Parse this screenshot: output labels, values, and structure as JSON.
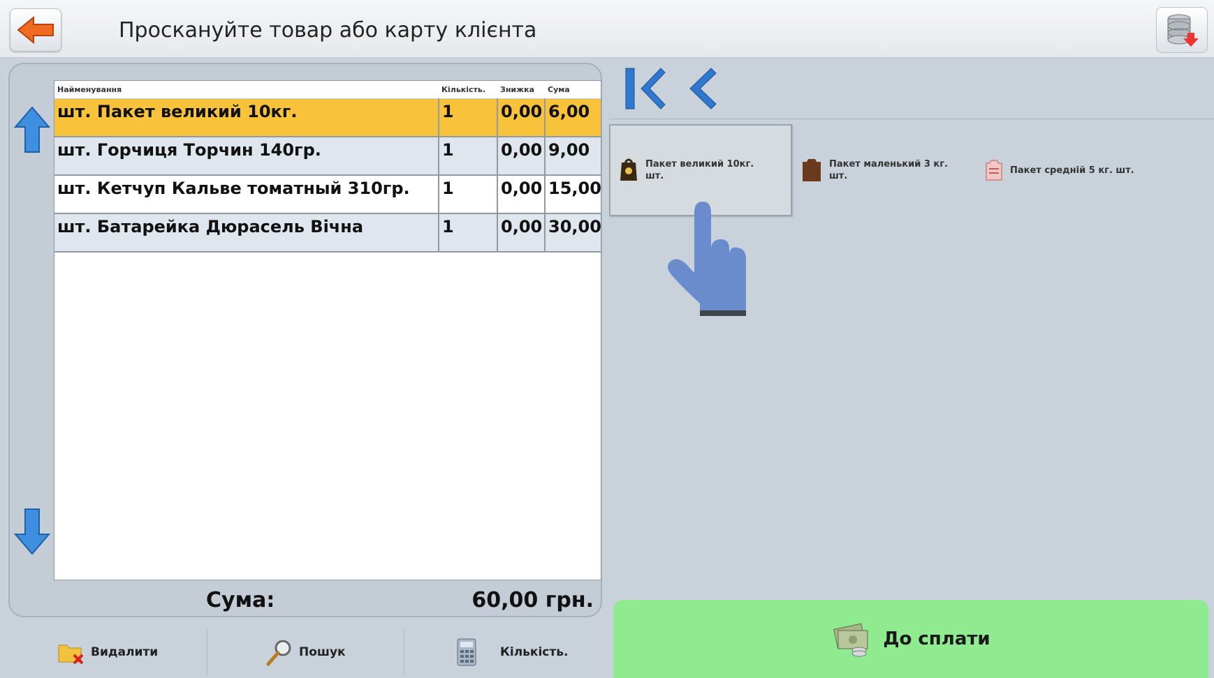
{
  "header": {
    "title": "Проскануйте товар або карту клієнта"
  },
  "table": {
    "columns": [
      "Найменування",
      "Кількість.",
      "Знижка",
      "Сума"
    ],
    "rows": [
      {
        "name": "шт. Пакет великий 10кг.",
        "qty": "1",
        "discount": "0,00",
        "sum": "6,00",
        "selected": true
      },
      {
        "name": "шт. Горчиця  Торчин 140гр.",
        "qty": "1",
        "discount": "0,00",
        "sum": "9,00"
      },
      {
        "name": "шт. Кетчуп Кальве томатный 310гр.",
        "qty": "1",
        "discount": "0,00",
        "sum": "15,00"
      },
      {
        "name": "шт. Батарейка Дюрасель Вічна",
        "qty": "1",
        "discount": "0,00",
        "sum": "30,00"
      }
    ]
  },
  "total": {
    "label": "Сума:",
    "value": "60,00 грн."
  },
  "bottom_buttons": {
    "delete": "Видалити",
    "search": "Пошук",
    "quantity": "Кількість."
  },
  "products": [
    {
      "line1": "Пакет великий 10кг.",
      "line2": "шт."
    },
    {
      "line1": "Пакет маленький 3 кг.",
      "line2": "шт."
    },
    {
      "line1": "Пакет средній 5 кг. шт.",
      "line2": ""
    }
  ],
  "pay": {
    "label": "До сплати"
  },
  "colors": {
    "selected_row": "#f8c33b",
    "pay_button": "#90ea8f",
    "arrow_blue": "#2f78d0"
  }
}
